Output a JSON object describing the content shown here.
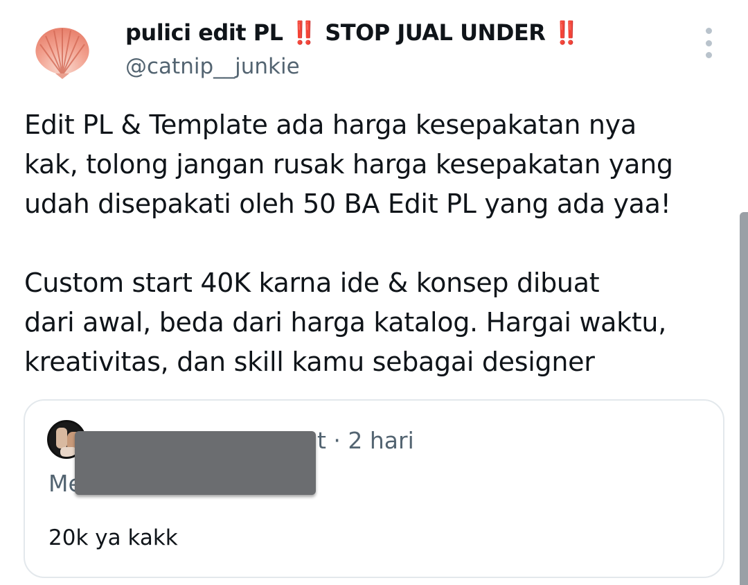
{
  "author": {
    "display_name_prefix": "pulici edit PL ",
    "emoji_double_exclamation": "‼️",
    "display_name_middle": " STOP JUAL UNDER ",
    "handle": "@catnip__junkie",
    "avatar_icon": "seashell-icon"
  },
  "menu": {
    "icon": "more-vertical-icon"
  },
  "tweet": {
    "lines_par1": [
      "Edit PL & Template ada harga kesepakatan nya",
      "kak, tolong jangan rusak harga kesepakatan yang",
      "udah disepakati oleh 50 BA Edit PL yang ada yaa!"
    ],
    "lines_par2": [
      "Custom start 40K karna ide & konsep dibuat",
      "dari awal, beda dari harga katalog. Hargai waktu,",
      "kreativitas, dan skill kamu sebagai designer"
    ]
  },
  "quoted": {
    "meta": "t · 2 hari",
    "reply_to_partial": "Me",
    "text": "20k ya kakk"
  },
  "colors": {
    "text_primary": "#0f1419",
    "text_secondary": "#536471",
    "emoji_red": "#e0212b",
    "card_border": "#e3e8ec",
    "redaction_gray": "#6b6d70"
  }
}
